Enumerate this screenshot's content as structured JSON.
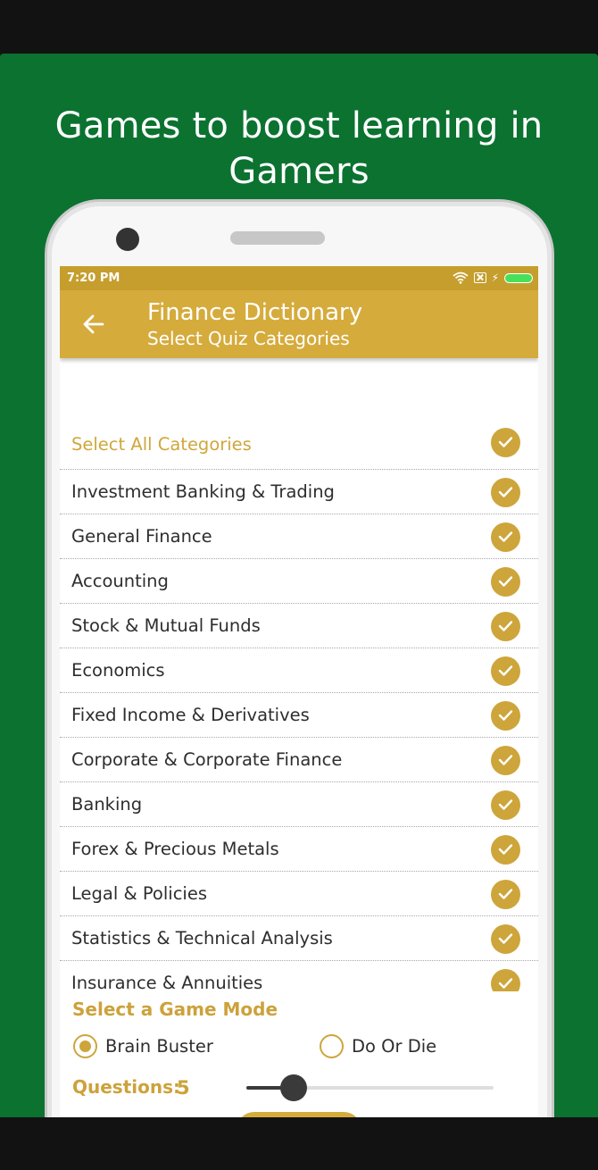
{
  "promo": {
    "headline": "Games to boost learning in Gamers",
    "background_color": "#0b7230"
  },
  "status_bar": {
    "time": "7:20 PM",
    "icons": [
      "wifi-icon",
      "sim-icon",
      "charging-icon",
      "battery-icon"
    ]
  },
  "app_bar": {
    "title": "Finance Dictionary",
    "subtitle": "Select Quiz Categories",
    "back_icon": "arrow-left-icon",
    "color": "#d5ab3c"
  },
  "categories": {
    "select_all_label": "Select All Categories",
    "select_all_checked": true,
    "items": [
      {
        "label": "Investment Banking & Trading",
        "checked": true
      },
      {
        "label": "General Finance",
        "checked": true
      },
      {
        "label": "Accounting",
        "checked": true
      },
      {
        "label": "Stock & Mutual Funds",
        "checked": true
      },
      {
        "label": "Economics",
        "checked": true
      },
      {
        "label": "Fixed Income & Derivatives",
        "checked": true
      },
      {
        "label": "Corporate & Corporate Finance",
        "checked": true
      },
      {
        "label": "Banking",
        "checked": true
      },
      {
        "label": "Forex & Precious Metals",
        "checked": true
      },
      {
        "label": "Legal & Policies",
        "checked": true
      },
      {
        "label": "Statistics & Technical Analysis",
        "checked": true
      },
      {
        "label": "Insurance & Annuities",
        "checked": true
      }
    ]
  },
  "game_mode": {
    "title": "Select a Game Mode",
    "options": [
      {
        "label": "Brain Buster",
        "selected": true
      },
      {
        "label": "Do Or Die",
        "selected": false
      }
    ]
  },
  "questions": {
    "label": "Questions:",
    "value": "5",
    "slider_fraction": 0.19
  },
  "accent_color": "#cda53b"
}
